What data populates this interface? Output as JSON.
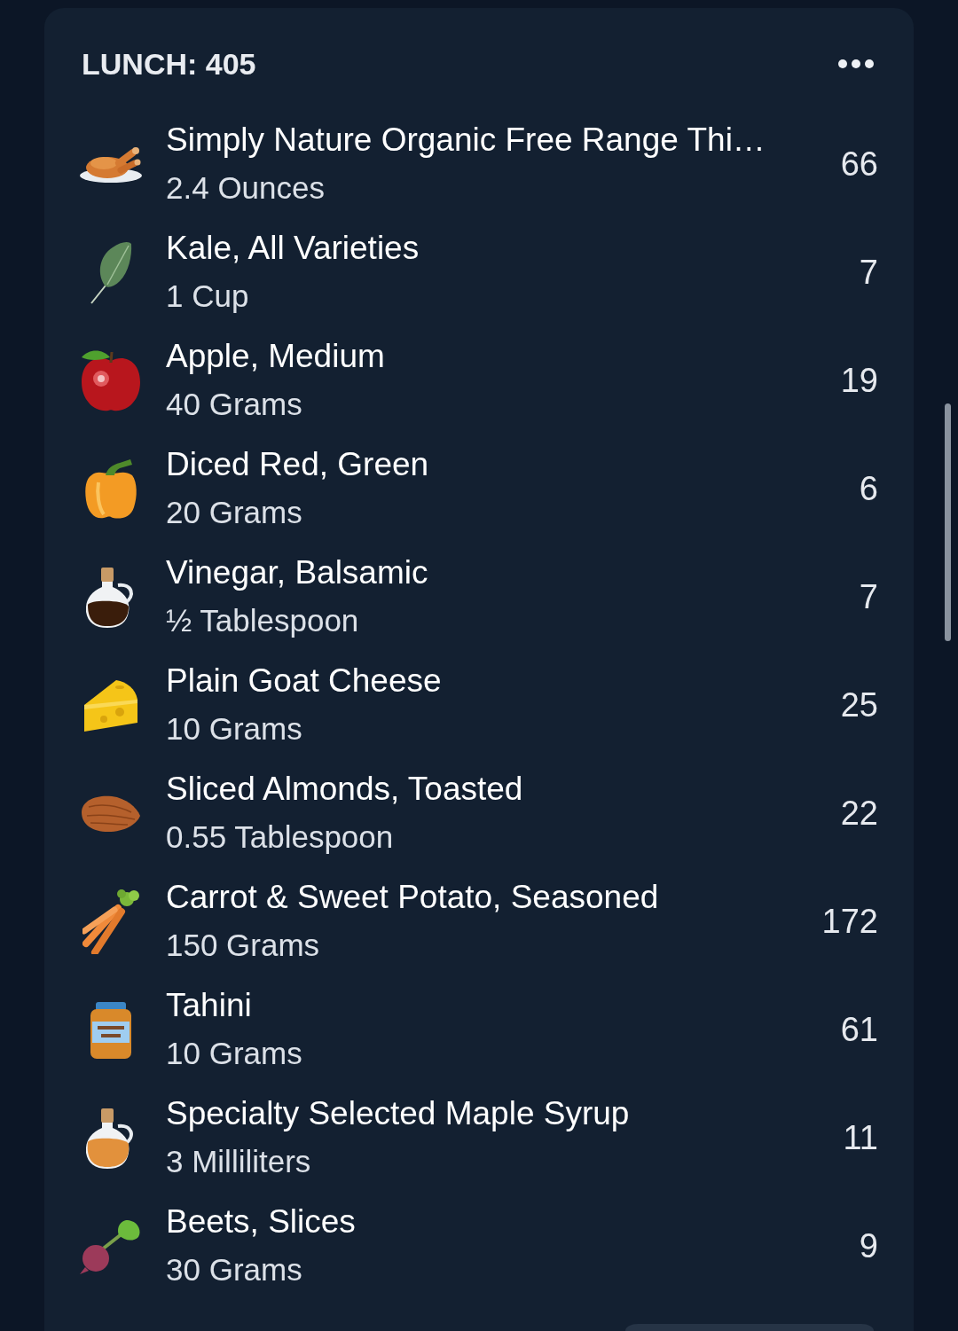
{
  "meal": {
    "title": "LUNCH: 405"
  },
  "items": [
    {
      "kind": "chicken",
      "name": "Simply Nature Organic Free Range Thi…",
      "amount": "2.4 Ounces",
      "calories": "66"
    },
    {
      "kind": "kale",
      "name": "Kale, All Varieties",
      "amount": "1 Cup",
      "calories": "7"
    },
    {
      "kind": "apple",
      "name": "Apple, Medium",
      "amount": "40 Grams",
      "calories": "19"
    },
    {
      "kind": "pepper",
      "name": "Diced Red, Green",
      "amount": "20 Grams",
      "calories": "6"
    },
    {
      "kind": "vinegar",
      "name": "Vinegar, Balsamic",
      "amount": "½ Tablespoon",
      "calories": "7"
    },
    {
      "kind": "cheese",
      "name": "Plain Goat Cheese",
      "amount": "10 Grams",
      "calories": "25"
    },
    {
      "kind": "almond",
      "name": "Sliced Almonds, Toasted",
      "amount": "0.55 Tablespoon",
      "calories": "22"
    },
    {
      "kind": "carrot",
      "name": "Carrot & Sweet Potato, Seasoned",
      "amount": "150 Grams",
      "calories": "172"
    },
    {
      "kind": "jar",
      "name": "Tahini",
      "amount": "10 Grams",
      "calories": "61"
    },
    {
      "kind": "syrup",
      "name": "Specialty Selected Maple Syrup",
      "amount": "3 Milliliters",
      "calories": "11"
    },
    {
      "kind": "beet",
      "name": "Beets, Slices",
      "amount": "30 Grams",
      "calories": "9"
    }
  ]
}
